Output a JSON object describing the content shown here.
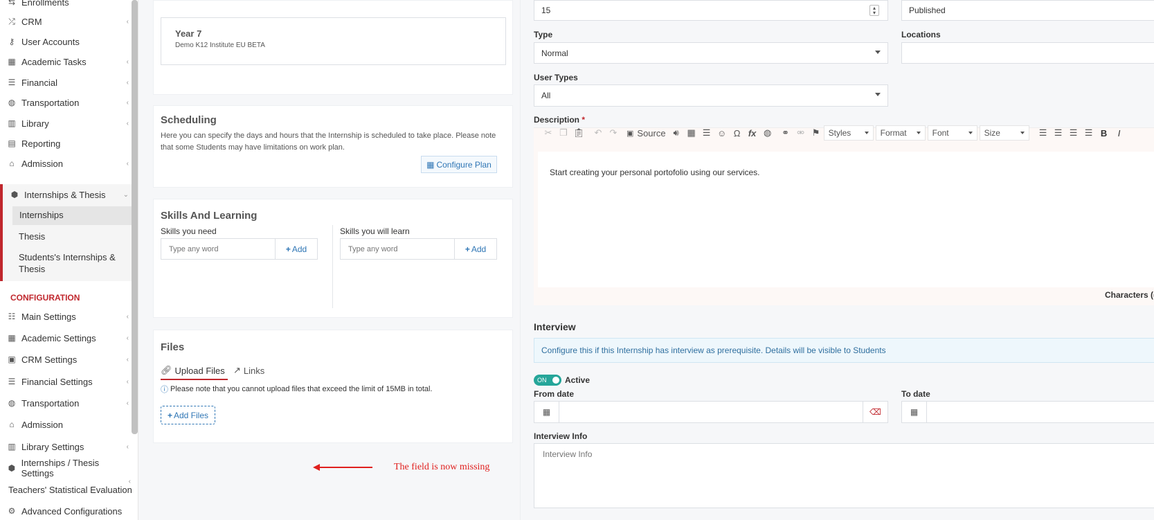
{
  "sidebar": {
    "items": [
      {
        "label": "Enrollments",
        "icon": "enrollments-icon"
      },
      {
        "label": "CRM",
        "icon": "crm-icon"
      },
      {
        "label": "User Accounts",
        "icon": "key-icon"
      },
      {
        "label": "Academic Tasks",
        "icon": "grid-icon"
      },
      {
        "label": "Financial",
        "icon": "coins-icon"
      },
      {
        "label": "Transportation",
        "icon": "bus-icon"
      },
      {
        "label": "Library",
        "icon": "books-icon"
      },
      {
        "label": "Reporting",
        "icon": "report-icon"
      },
      {
        "label": "Admission",
        "icon": "institution-icon"
      },
      {
        "label": "Internships & Thesis",
        "icon": "cube-icon"
      }
    ],
    "sub_items": [
      "Internships",
      "Thesis",
      "Students's Internships &",
      "Thesis"
    ],
    "config_section": "CONFIGURATION",
    "config_items": [
      {
        "label": "Main Settings",
        "icon": "sliders-icon"
      },
      {
        "label": "Academic Settings",
        "icon": "grid-icon"
      },
      {
        "label": "CRM Settings",
        "icon": "crm-settings-icon"
      },
      {
        "label": "Financial Settings",
        "icon": "coins-icon"
      },
      {
        "label": "Transportation",
        "icon": "bus-icon"
      },
      {
        "label": "Admission",
        "icon": "institution-icon"
      },
      {
        "label": "Library Settings",
        "icon": "books-icon"
      },
      {
        "label": "Internships / Thesis Settings",
        "icon": "cube-icon"
      },
      {
        "label": "Teachers' Statistical Evaluation",
        "icon": ""
      },
      {
        "label": "Advanced Configurations",
        "icon": "gears-icon"
      }
    ]
  },
  "year_card": {
    "title": "Year 7",
    "subtitle": "Demo K12 Institute EU BETA"
  },
  "scheduling": {
    "title": "Scheduling",
    "description": "Here you can specify the days and hours that the Internship is scheduled to take place. Please note that some Students may have limitations on work plan.",
    "configure_label": "Configure Plan"
  },
  "skills": {
    "title": "Skills And Learning",
    "need_label": "Skills you need",
    "learn_label": "Skills you will learn",
    "placeholder": "Type any word",
    "add_label": "Add"
  },
  "files": {
    "title": "Files",
    "tab_upload": "Upload Files",
    "tab_links": "Links",
    "note": "Please note that you cannot upload files that exceed the limit of 15MB in total.",
    "add_files": "Add Files"
  },
  "annotation": {
    "text": "The field is now missing",
    "color": "#e0201e"
  },
  "form": {
    "number_value": "15",
    "status_value": "Published",
    "type_label": "Type",
    "type_value": "Normal",
    "locations_label": "Locations",
    "user_types_label": "User Types",
    "user_types_value": "All",
    "description_label": "Description",
    "required_mark": "*",
    "editor": {
      "source_label": "Source",
      "styles": "Styles",
      "format": "Format",
      "font": "Font",
      "size": "Size",
      "content": "Start creating your personal portofolio using our services.",
      "characters_label": "Characters (("
    }
  },
  "interview": {
    "title": "Interview",
    "info_text": "Configure this if this Internship has interview as prerequisite. Details will be visible to Students",
    "toggle_on": "ON",
    "active_label": "Active",
    "from_label": "From date",
    "to_label": "To date",
    "info_label": "Interview Info",
    "info_placeholder": "Interview Info"
  },
  "colors": {
    "accent": "#c0272d",
    "link": "#2f76b5",
    "toggle": "#26a69a",
    "info_bg": "#eef7fc"
  }
}
